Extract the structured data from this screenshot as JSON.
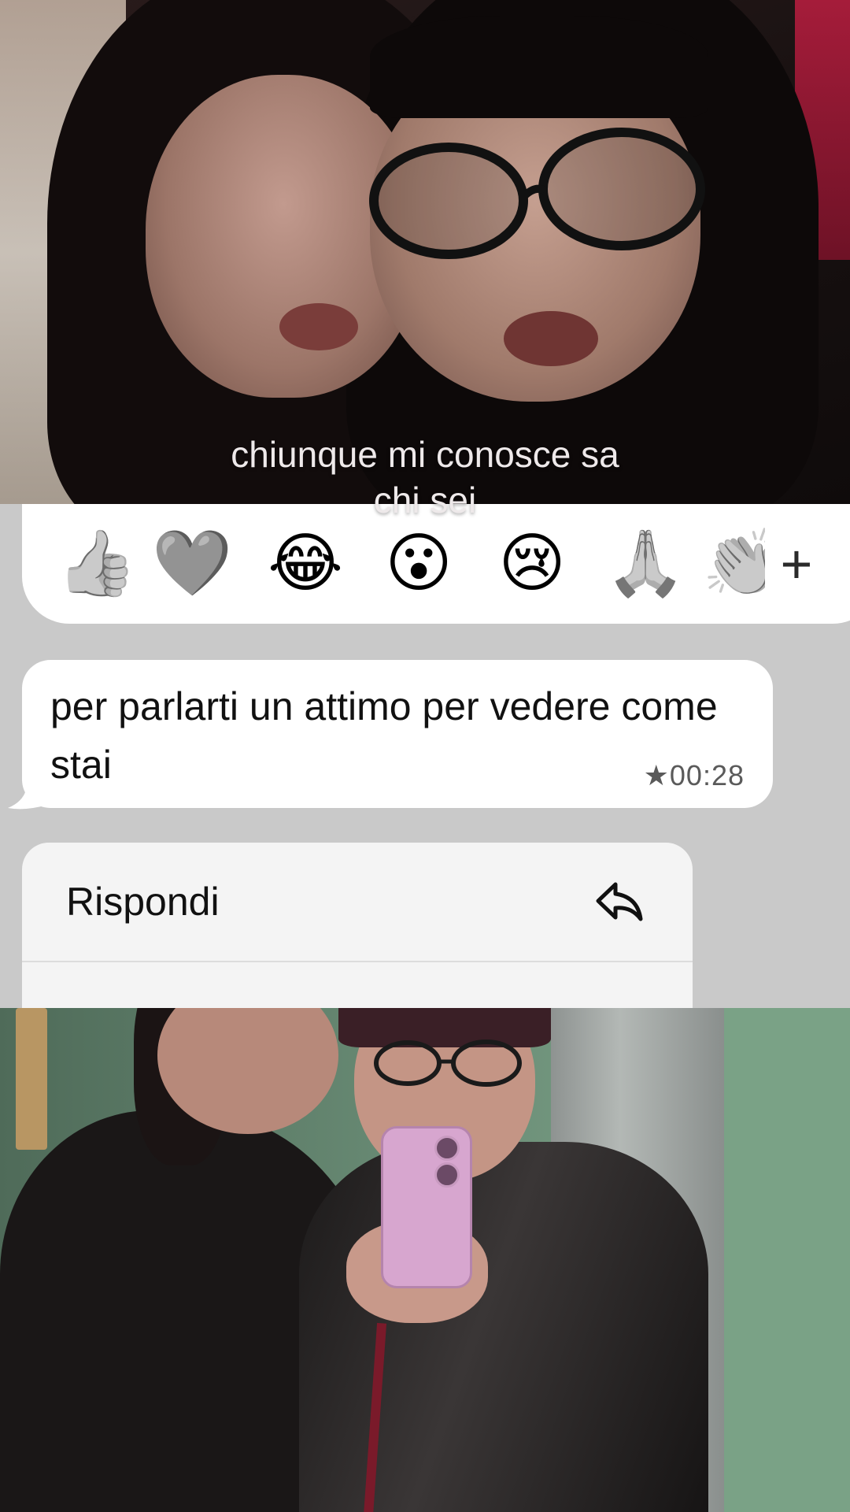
{
  "caption": {
    "line1": "chiunque mi conosce sa",
    "line2": "chi sei"
  },
  "reactions": {
    "items": [
      "👍",
      "🩶",
      "😂",
      "😮",
      "😢",
      "🙏",
      "👏"
    ],
    "more_label": "+"
  },
  "message": {
    "text": "per parlarti un attimo per vedere come stai",
    "time": "★00:28"
  },
  "context_menu": {
    "reply_label": "Rispondi",
    "reply_icon": "reply-icon"
  }
}
